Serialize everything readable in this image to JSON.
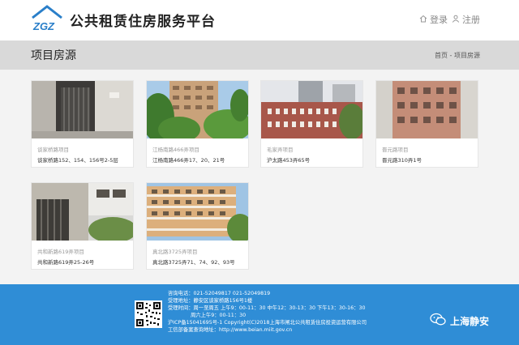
{
  "header": {
    "logo_text": "ZGZ",
    "site_title": "公共租赁住房服务平台",
    "login_label": "登录",
    "register_label": "注册"
  },
  "banner": {
    "page_title": "项目房源",
    "breadcrumb": "首页 - 项目房源"
  },
  "projects": [
    {
      "category": "谈家桥路项目",
      "address": "谈家桥路152、154、156号2-5层"
    },
    {
      "category": "江杨南路466弄项目",
      "address": "江杨南路466弄17、20、21号"
    },
    {
      "category": "毛家弄项目",
      "address": "沪太路453弄65号"
    },
    {
      "category": "晋元路项目",
      "address": "晋元路310弄1号"
    },
    {
      "category": "共和新路619弄项目",
      "address": "共和新路619弄25-26号"
    },
    {
      "category": "真北路3725弄项目",
      "address": "真北路3725弄71、74、92、93号"
    }
  ],
  "footer": {
    "lines": [
      "咨询电话：021-52049817    021-52049819",
      "受理地址：静安区谈家桥路156号1楼",
      "受理时间：周一至周五 上午9：00-11：30 中午12：30-13：30 下午13：30-16：30",
      "周六上午9：00-11：30",
      "沪ICP备15041695号-1 Copyright(C)2018上海市闸北公共租赁住房投资运营有限公司",
      "工信部备案查询地址：http://www.beian.miit.gov.cn"
    ],
    "wechat_label": "上海静安"
  },
  "colors": {
    "footer_bg": "#2f8dd6",
    "banner_bg": "#d9d9d9",
    "logo_blue": "#2a7fc9"
  }
}
